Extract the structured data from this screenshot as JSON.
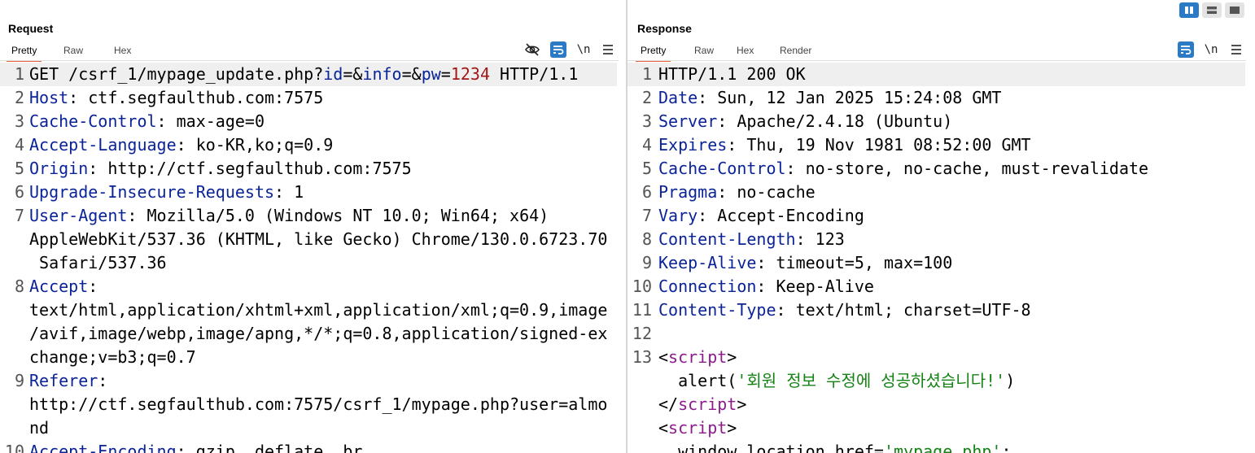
{
  "request": {
    "title": "Request",
    "tabs": [
      "Pretty",
      "Raw",
      "Hex"
    ],
    "active_tab": "Pretty",
    "newline_toggle": "\\n",
    "line_numbers": [
      "1",
      "2",
      "3",
      "4",
      "5",
      "6",
      "7",
      "8",
      "9",
      "10"
    ],
    "lines": {
      "l1": {
        "method": "GET /csrf_1/mypage_update.php?",
        "p1": "id",
        "eq1": "=&",
        "p2": "info",
        "eq2": "=&",
        "p3": "pw",
        "eq3": "=",
        "v3": "1234",
        "tail": " HTTP/1.1"
      },
      "l2": {
        "key": "Host",
        "val": ": ctf.segfaulthub.com:7575"
      },
      "l3": {
        "key": "Cache-Control",
        "val": ": max-age=0"
      },
      "l4": {
        "key": "Accept-Language",
        "val": ": ko-KR,ko;q=0.9"
      },
      "l5": {
        "key": "Origin",
        "val": ": http://ctf.segfaulthub.com:7575"
      },
      "l6": {
        "key": "Upgrade-Insecure-Requests",
        "val": ": 1"
      },
      "l7": {
        "key": "User-Agent",
        "val": ": Mozilla/5.0 (Windows NT 10.0; Win64; x64)",
        "w1": "AppleWebKit/537.36 (KHTML, like Gecko) Chrome/130.0.6723.70",
        "w2": " Safari/537.36"
      },
      "l8": {
        "key": "Accept",
        "val": ":",
        "w1": "text/html,application/xhtml+xml,application/xml;q=0.9,image",
        "w2": "/avif,image/webp,image/apng,*/*;q=0.8,application/signed-ex",
        "w3": "change;v=b3;q=0.7"
      },
      "l9": {
        "key": "Referer",
        "val": ":",
        "w1": "http://ctf.segfaulthub.com:7575/csrf_1/mypage.php?user=almo",
        "w2": "nd"
      },
      "l10": {
        "key": "Accept-Encoding",
        "val": ": gzip, deflate, br"
      }
    }
  },
  "response": {
    "title": "Response",
    "tabs": [
      "Pretty",
      "Raw",
      "Hex",
      "Render"
    ],
    "active_tab": "Pretty",
    "newline_toggle": "\\n",
    "line_numbers": [
      "1",
      "2",
      "3",
      "4",
      "5",
      "6",
      "7",
      "8",
      "9",
      "10",
      "11",
      "12",
      "13"
    ],
    "lines": {
      "l1": {
        "text": "HTTP/1.1 200 OK"
      },
      "l2": {
        "key": "Date",
        "val": ": Sun, 12 Jan 2025 15:24:08 GMT"
      },
      "l3": {
        "key": "Server",
        "val": ": Apache/2.4.18 (Ubuntu)"
      },
      "l4": {
        "key": "Expires",
        "val": ": Thu, 19 Nov 1981 08:52:00 GMT"
      },
      "l5": {
        "key": "Cache-Control",
        "val": ": no-store, no-cache, must-revalidate"
      },
      "l6": {
        "key": "Pragma",
        "val": ": no-cache"
      },
      "l7": {
        "key": "Vary",
        "val": ": Accept-Encoding"
      },
      "l8": {
        "key": "Content-Length",
        "val": ": 123"
      },
      "l9": {
        "key": "Keep-Alive",
        "val": ": timeout=5, max=100"
      },
      "l10": {
        "key": "Connection",
        "val": ": Keep-Alive"
      },
      "l11": {
        "key": "Content-Type",
        "val": ": text/html; charset=UTF-8"
      },
      "l13": {
        "lt": "<",
        "tag": "script",
        "gt": ">"
      },
      "l14": {
        "pre": "  alert(",
        "str": "'회원 정보 수정에 성공하셨습니다!'",
        "post": ")"
      },
      "l15": {
        "lt": "</",
        "tag": "script",
        "gt": ">"
      },
      "l16": {
        "lt": "<",
        "tag": "script",
        "gt": ">"
      },
      "l17": {
        "pre": "  window.location.href=",
        "str": "'mypage.php'",
        "post": ";"
      }
    }
  },
  "icons": {
    "hide": "eye-slash-icon",
    "wrap": "word-wrap-icon",
    "menu": "hamburger-menu-icon",
    "layout": [
      "layout-side-by-side-icon",
      "layout-stacked-icon",
      "layout-single-icon"
    ]
  },
  "colors": {
    "header_key": "#0a2397",
    "param_value": "#a11717",
    "tag": "#8d1b8d",
    "string": "#148314",
    "active_tab_underline": "#e8613d",
    "accent_blue": "#2a7ac6"
  }
}
